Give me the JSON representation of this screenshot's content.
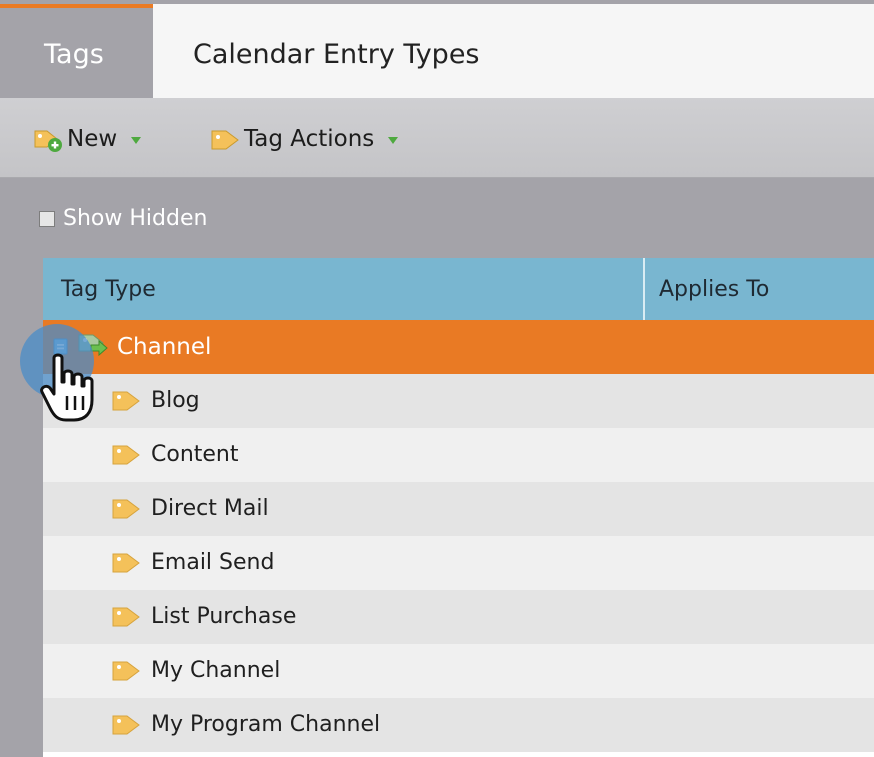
{
  "tabs": [
    {
      "label": "Tags",
      "active": true
    },
    {
      "label": "Calendar Entry Types",
      "active": false
    }
  ],
  "toolbar": {
    "new_label": "New",
    "tag_actions_label": "Tag Actions"
  },
  "filter": {
    "show_hidden_label": "Show Hidden",
    "show_hidden_checked": false
  },
  "grid": {
    "columns": [
      "Tag Type",
      "Applies To"
    ],
    "parent": {
      "label": "Channel",
      "expanded": true,
      "selected": true
    },
    "children": [
      {
        "label": "Blog"
      },
      {
        "label": "Content"
      },
      {
        "label": "Direct Mail"
      },
      {
        "label": "Email Send"
      },
      {
        "label": "List Purchase"
      },
      {
        "label": "My Channel"
      },
      {
        "label": "My Program Channel"
      }
    ]
  },
  "colors": {
    "accent_orange": "#e97a24",
    "header_blue": "#79b6d0",
    "panel_gray": "#a4a3a9",
    "tag_yellow": "#f4c15a",
    "caret_green": "#4ea93f"
  }
}
